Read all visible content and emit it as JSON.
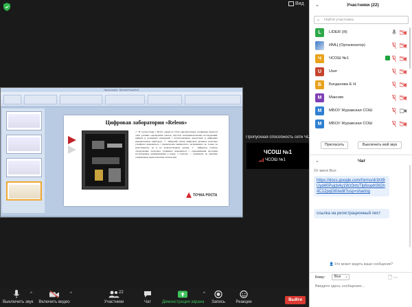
{
  "top": {
    "view_label": "Вид"
  },
  "share": {
    "ppt_title": "Презентация1 - Microsoft PowerPoint",
    "slide_title": "Цифровая лаборатория «Releon»",
    "slide_text": "✓ В соответствии с ФГОС одним из УУД, приобретаемых учениками, является опыт ученика «проведения опытов, простых экспериментальных исследований, прямых и косвенных измерений с использованием аналоговых и цифровых измерительных приборов». ✓ Широкий спектр цифровых датчиков позволяет учащимся знакомиться с параметрами химического эксперимента не только на качественном, но и на количественном уровне. ✓ Цифровое учебное оборудование позволяет учащимся знакомиться с современными методами исследования, применяемыми в науке, а учителю — применять на практике современные педагогические технологии.",
    "brand": "ТОЧКА РОСТА"
  },
  "tile": {
    "caption": "Пропускная способность сети ЧСОШ",
    "name": "ЧСОШ №1",
    "sub": "ЧСОШ №1"
  },
  "toolbar": {
    "mute": "Выключить звук",
    "video": "Включить видео",
    "participants": "Участники",
    "participants_count": "22",
    "chat": "Чат",
    "share": "Демонстрация экрана",
    "record": "Запись",
    "reactions": "Реакции",
    "leave": "Выйти"
  },
  "participants_panel": {
    "title": "Участники (22)",
    "search_placeholder": "Найти участника",
    "items": [
      {
        "initial": "L",
        "color": "#2fa84a",
        "name": "LIDER (Я)"
      },
      {
        "initial": "",
        "color": "#3a79c7",
        "name": "ИМЦ (Организатор)"
      },
      {
        "initial": "Ч",
        "color": "#e8a21c",
        "name": "ЧСОШ №1"
      },
      {
        "initial": "U",
        "color": "#c6442d",
        "name": "User"
      },
      {
        "initial": "Б",
        "color": "#e8a21c",
        "name": "Богданова Е Н"
      },
      {
        "initial": "М",
        "color": "#7e3fb5",
        "name": "Максим"
      },
      {
        "initial": "М",
        "color": "#2f7fd1",
        "name": "МБОУ Журавская СОШ"
      },
      {
        "initial": "М",
        "color": "#2f7fd1",
        "name": "МБОУ Журавская СОШ"
      }
    ],
    "invite_label": "Пригласить",
    "mute_all_label": "Выключить мой звук"
  },
  "chat_panel": {
    "title": "Чат",
    "from_label": "От меня Все:",
    "messages": [
      {
        "text": "https://docs.google.com/forms/d/1KtBUyd40Pujcb4y1Wz0ntvTlp6xaxK9lGh4C12pqGl0/edit?usp=sharing"
      },
      {
        "text": "ссылка на регистрационный лист"
      }
    ],
    "who_sees": "Кто может видеть ваши сообщения?",
    "to_label": "Кому:",
    "to_value": "Все",
    "input_placeholder": "Введите здесь сообщение..."
  },
  "colors": {
    "accent_green": "#3ec35a",
    "end_red": "#d93a32",
    "link_blue": "#1f5fbf"
  }
}
